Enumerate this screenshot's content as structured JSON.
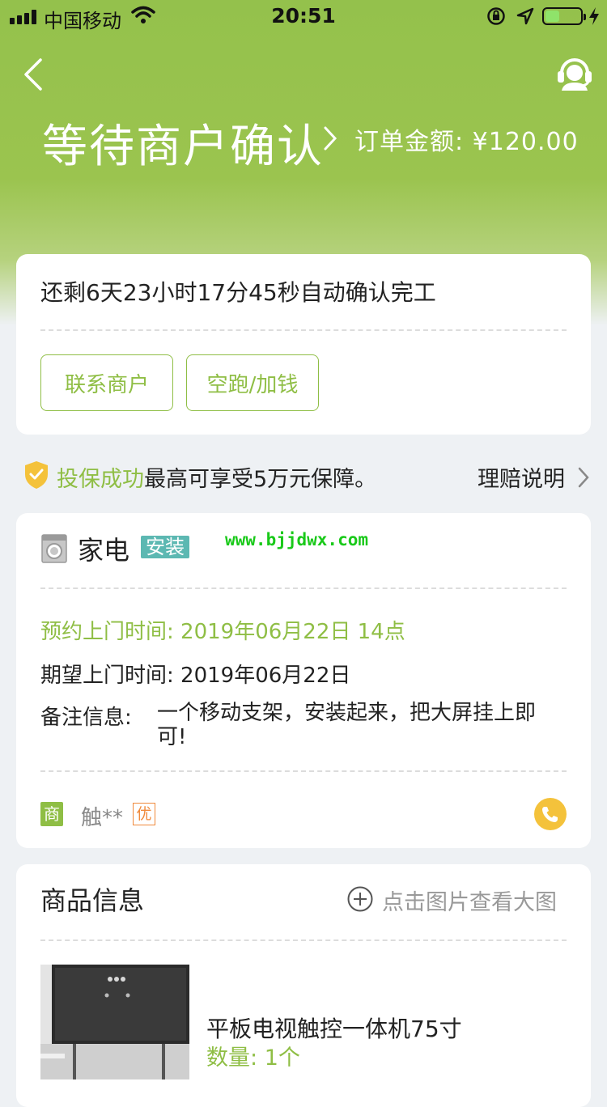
{
  "status_bar": {
    "carrier": "中国移动",
    "time": "20:51",
    "battery_level": 0.4
  },
  "header": {
    "title": "等待商户确认",
    "amount_label": "订单金额:",
    "amount_value": "¥120.00"
  },
  "countdown": {
    "text": "还剩6天23小时17分45秒自动确认完工"
  },
  "actions": {
    "contact_label": "联系商户",
    "extra_label": "空跑/加钱"
  },
  "insurance": {
    "status": "投保成功",
    "detail": "最高可享受5万元保障。",
    "claim_label": "理赔说明"
  },
  "service": {
    "category": "家电",
    "tag": "安装",
    "watermark": "www.bjjdwx.com",
    "appointment_label": "预约上门时间:",
    "appointment_value": "2019年06月22日 14点",
    "expected_label": "期望上门时间:",
    "expected_value": "2019年06月22日",
    "remark_label": "备注信息:",
    "remark_value": "一个移动支架，安装起来，把大屏挂上即可!"
  },
  "merchant": {
    "badge": "商",
    "name": "触**",
    "vip_badge": "优"
  },
  "goods": {
    "title": "商品信息",
    "view_large_label": "点击图片查看大图",
    "product_name": "平板电视触控一体机75寸",
    "quantity_label": "数量:",
    "quantity_value": "1个"
  },
  "colors": {
    "brand_green": "#8fbe45",
    "header_green": "#94c14c",
    "tag_teal": "#5cb8b2",
    "call_yellow": "#f4c23b",
    "vip_orange": "#f08a3c"
  }
}
